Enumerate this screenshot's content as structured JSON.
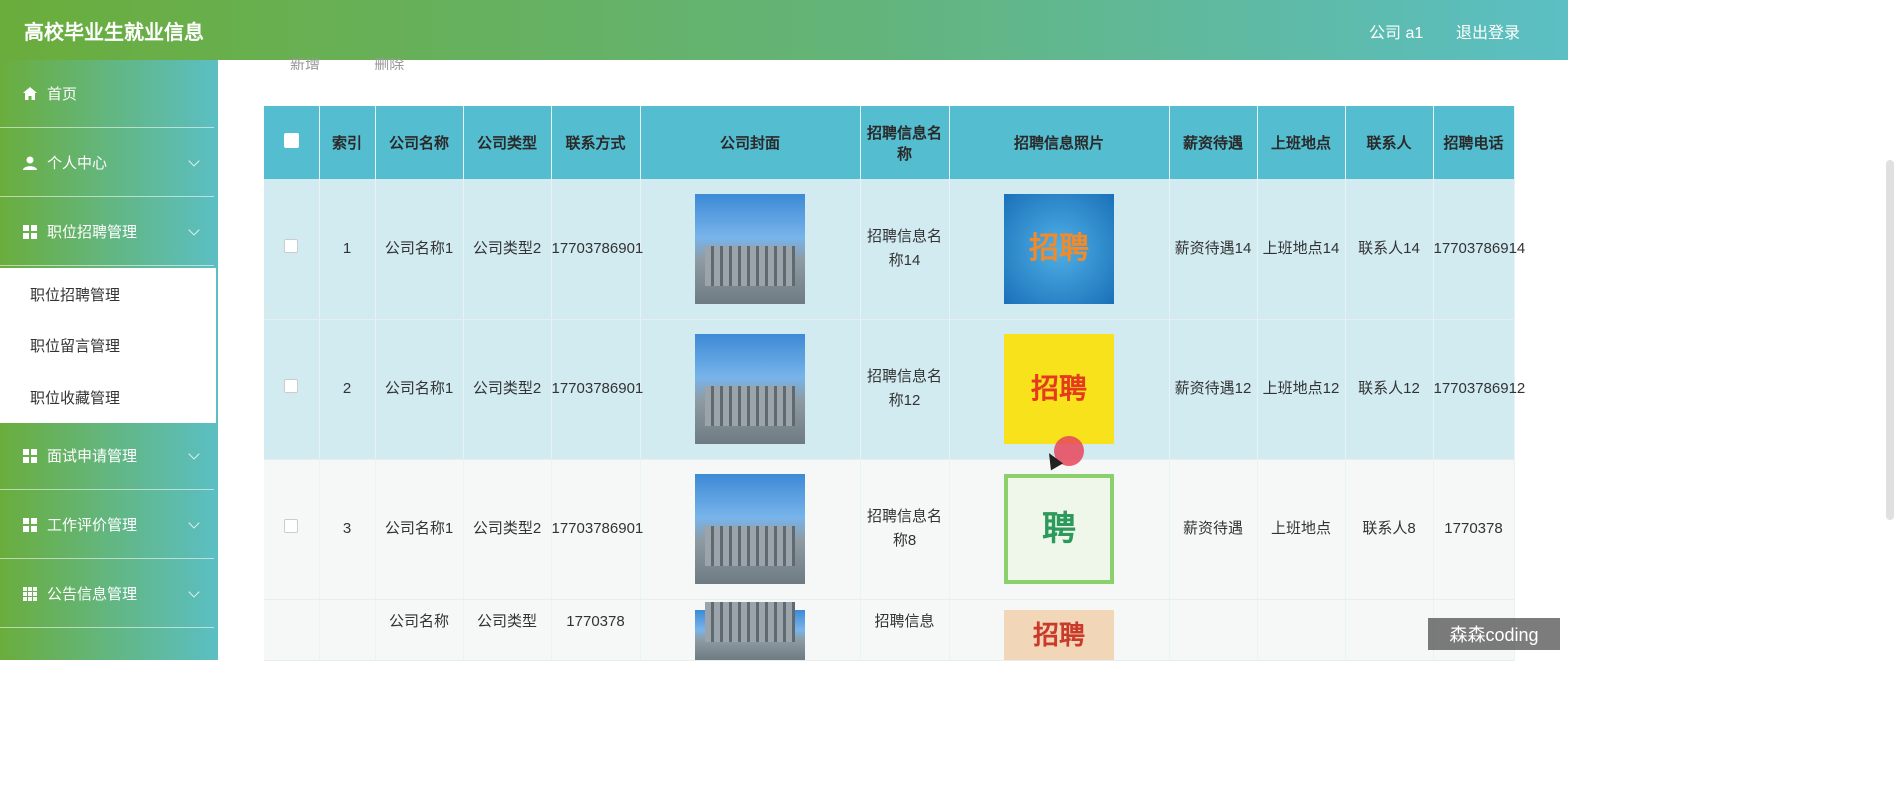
{
  "header": {
    "title": "高校毕业生就业信息",
    "user": "公司 a1",
    "logout": "退出登录"
  },
  "sidebar": {
    "items": [
      {
        "label": "首页",
        "icon": "home-icon"
      },
      {
        "label": "个人中心",
        "icon": "user-icon"
      },
      {
        "label": "职位招聘管理",
        "icon": "grid-icon"
      },
      {
        "label": "面试申请管理",
        "icon": "grid-icon"
      },
      {
        "label": "工作评价管理",
        "icon": "grid-icon"
      },
      {
        "label": "公告信息管理",
        "icon": "apps-icon"
      }
    ],
    "submenu": [
      "职位招聘管理",
      "职位留言管理",
      "职位收藏管理"
    ]
  },
  "toolbar": {
    "add_label": "新增",
    "delete_label": "删除"
  },
  "table": {
    "headers": [
      "索引",
      "公司名称",
      "公司类型",
      "联系方式",
      "公司封面",
      "招聘信息名称",
      "招聘信息照片",
      "薪资待遇",
      "上班地点",
      "联系人",
      "招聘电话"
    ],
    "rows": [
      {
        "index": "1",
        "company_name": "公司名称1",
        "company_type": "公司类型2",
        "contact": "17703786901",
        "job_name": "招聘信息名称14",
        "photo_text": "招聘",
        "salary": "薪资待遇14",
        "location": "上班地点14",
        "contact_person": "联系人14",
        "phone": "17703786914"
      },
      {
        "index": "2",
        "company_name": "公司名称1",
        "company_type": "公司类型2",
        "contact": "17703786901",
        "job_name": "招聘信息名称12",
        "photo_text": "招聘",
        "salary": "薪资待遇12",
        "location": "上班地点12",
        "contact_person": "联系人12",
        "phone": "17703786912"
      },
      {
        "index": "3",
        "company_name": "公司名称1",
        "company_type": "公司类型2",
        "contact": "17703786901",
        "job_name": "招聘信息名称8",
        "photo_text": "聘",
        "salary": "薪资待遇",
        "location": "上班地点",
        "contact_person": "联系人8",
        "phone": "1770378"
      },
      {
        "index": "",
        "company_name": "公司名称",
        "company_type": "公司类型",
        "contact": "1770378",
        "job_name": "招聘信息",
        "photo_text": "招聘",
        "salary": "",
        "location": "",
        "contact_person": "",
        "phone": ""
      }
    ]
  },
  "watermark": "森森coding",
  "colors": {
    "header_start": "#6aad3c",
    "header_end": "#5bbfc4",
    "table_header": "#55bdd0",
    "selected_row": "#d1ebf1"
  }
}
